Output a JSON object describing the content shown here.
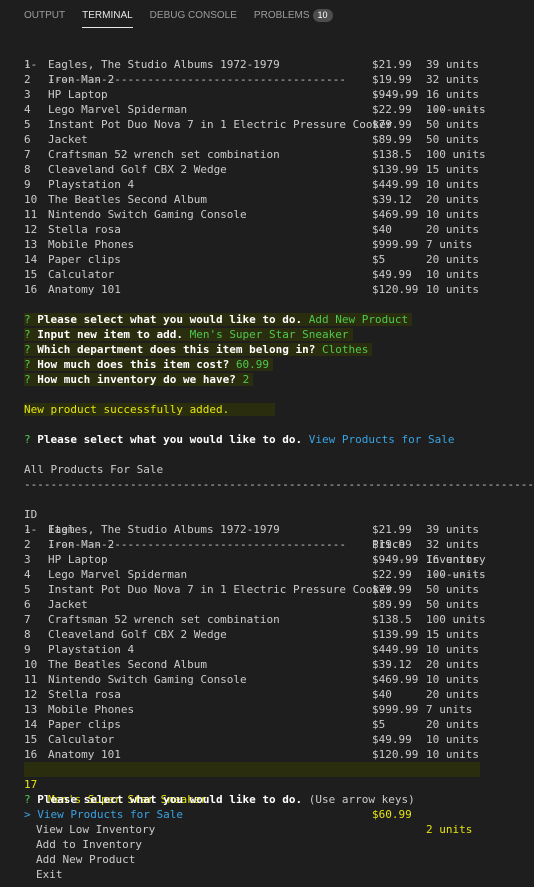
{
  "tabs": [
    {
      "label": "OUTPUT"
    },
    {
      "label": "TERMINAL"
    },
    {
      "label": "DEBUG CONSOLE"
    },
    {
      "label": "PROBLEMS"
    }
  ],
  "problems_count": "10",
  "dash_row": {
    "id": "--",
    "name": "---------------------------------------------",
    "price": "-------",
    "inv": "---------"
  },
  "table1": [
    {
      "id": "1",
      "name": "Eagles, The Studio Albums 1972-1979",
      "price": "$21.99",
      "inv": "39 units"
    },
    {
      "id": "2",
      "name": "Iron Man 2",
      "price": "$19.99",
      "inv": "32 units"
    },
    {
      "id": "3",
      "name": "HP Laptop",
      "price": "$949.99",
      "inv": "16 units"
    },
    {
      "id": "4",
      "name": "Lego Marvel Spiderman",
      "price": "$22.99",
      "inv": "100 units"
    },
    {
      "id": "5",
      "name": "Instant Pot Duo Nova 7 in 1 Electric Pressure Cooker",
      "price": "$79.99",
      "inv": "50 units"
    },
    {
      "id": "6",
      "name": "Jacket",
      "price": "$89.99",
      "inv": "50 units"
    },
    {
      "id": "7",
      "name": "Craftsman 52 wrench set combination",
      "price": "$138.5",
      "inv": "100 units"
    },
    {
      "id": "8",
      "name": "Cleaveland Golf CBX 2 Wedge",
      "price": "$139.99",
      "inv": "15 units"
    },
    {
      "id": "9",
      "name": "Playstation 4",
      "price": "$449.99",
      "inv": "10 units"
    },
    {
      "id": "10",
      "name": "The Beatles Second Album",
      "price": "$39.12",
      "inv": "20 units"
    },
    {
      "id": "11",
      "name": "Nintendo Switch Gaming Console",
      "price": "$469.99",
      "inv": "10 units"
    },
    {
      "id": "12",
      "name": "Stella rosa",
      "price": "$40",
      "inv": "20 units"
    },
    {
      "id": "13",
      "name": "Mobile Phones",
      "price": "$999.99",
      "inv": "7 units"
    },
    {
      "id": "14",
      "name": "Paper clips",
      "price": "$5",
      "inv": "20 units"
    },
    {
      "id": "15",
      "name": "Calculator",
      "price": "$49.99",
      "inv": "10 units"
    },
    {
      "id": "16",
      "name": "Anatomy 101",
      "price": "$120.99",
      "inv": "10 units"
    }
  ],
  "prompts": [
    {
      "q": "?",
      "label": "Please select what you would like to do.",
      "answer": "Add New Product"
    },
    {
      "q": "?",
      "label": "Input new item to add.",
      "answer": "Men's Super Star Sneaker"
    },
    {
      "q": "?",
      "label": "Which department does this item belong in?",
      "answer": "Clothes"
    },
    {
      "q": "?",
      "label": "How much does this item cost?",
      "answer": "60.99"
    },
    {
      "q": "?",
      "label": "How much inventory do we have?",
      "answer": "2"
    }
  ],
  "success_msg": "New product successfully added.",
  "prompt2": {
    "q": "?",
    "label": "Please select what you would like to do.",
    "answer": "View Products for Sale"
  },
  "all_products_title": "All Products For Sale",
  "long_dash": "------------------------------------------------------------------------------",
  "header": {
    "id": "ID",
    "name": "Item",
    "price": "Price",
    "inv": "Inventory"
  },
  "new_row": {
    "id": "17",
    "name": "Men's Super Star Sneaker",
    "price": "$60.99",
    "inv": "2 units"
  },
  "prompt3": {
    "q": "?",
    "label": "Please select what you would like to do.",
    "hint": "(Use arrow keys)"
  },
  "menu": {
    "pointer": ">",
    "items": [
      "View Products for Sale",
      "View Low Inventory",
      "Add to Inventory",
      "Add New Product",
      "Exit"
    ]
  }
}
